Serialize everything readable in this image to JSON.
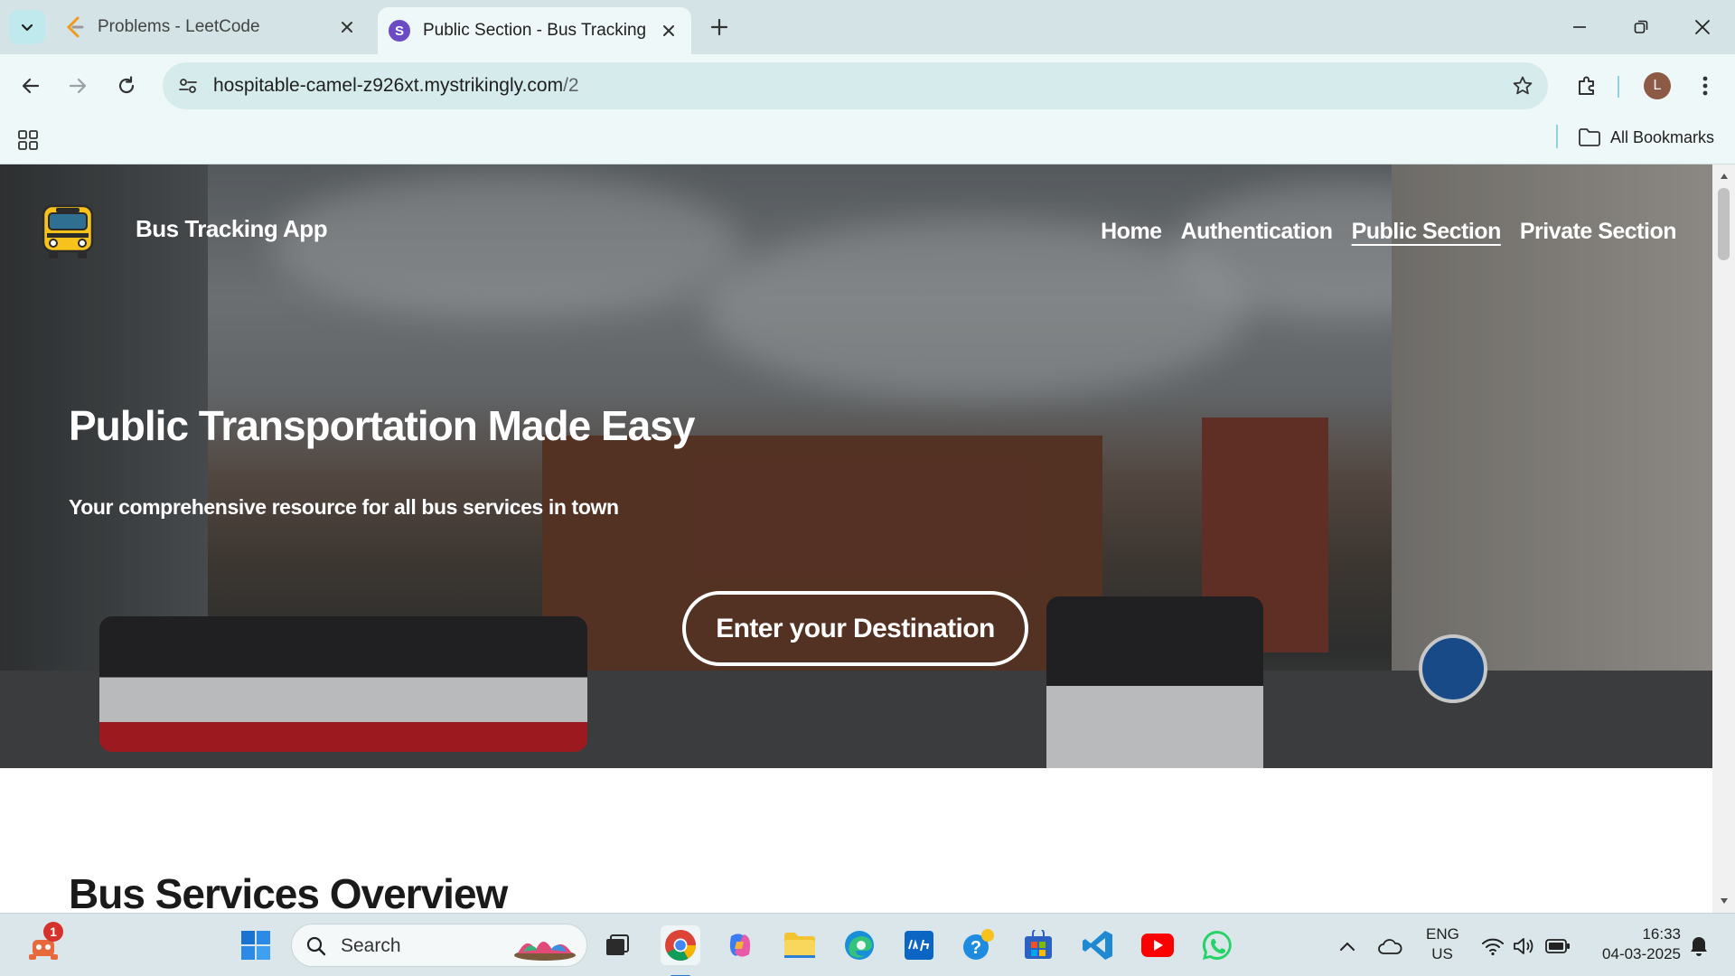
{
  "browser": {
    "tabs": [
      {
        "title": "Problems - LeetCode",
        "favicon": "leetcode-icon"
      },
      {
        "title": "Public Section - Bus Tracking Ap",
        "favicon_letter": "S"
      }
    ],
    "url_host": "hospitable-camel-z926xt.mystrikingly.com",
    "url_path": "/2",
    "avatar_letter": "L",
    "all_bookmarks_label": "All Bookmarks"
  },
  "site": {
    "brand": "Bus Tracking App",
    "nav": [
      {
        "label": "Home",
        "active": false
      },
      {
        "label": "Authentication",
        "active": false
      },
      {
        "label": "Public Section",
        "active": true
      },
      {
        "label": "Private Section",
        "active": false
      }
    ],
    "hero_title": "Public Transportation Made Easy",
    "hero_subtitle": "Your comprehensive resource for all bus services in town",
    "cta_label": "Enter your Destination",
    "section_title": "Bus Services Overview"
  },
  "taskbar": {
    "notification_count": "1",
    "search_placeholder": "Search",
    "language": "ENG",
    "region": "US",
    "time": "16:33",
    "date": "04-03-2025"
  },
  "colors": {
    "tabbar_bg": "#d3e3e6",
    "toolbar_bg": "#eef8f8",
    "omnibox_bg": "#d6ecec",
    "taskbar_bg": "#dbe6ea",
    "accent": "#2a78c8"
  }
}
